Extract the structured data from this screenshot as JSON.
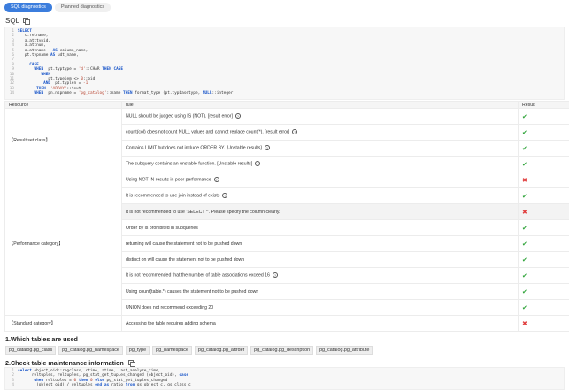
{
  "tabs": [
    "SQL diagnostics",
    "Planned diagnostics"
  ],
  "sql_section": {
    "title": "SQL",
    "lines": [
      {
        "n": "1",
        "parts": [
          {
            "t": "SELECT",
            "c": "kw"
          }
        ]
      },
      {
        "n": "2",
        "parts": [
          {
            "t": "   c.relname,",
            "c": ""
          }
        ]
      },
      {
        "n": "3",
        "parts": [
          {
            "t": "   a.atttypid,",
            "c": ""
          }
        ]
      },
      {
        "n": "4",
        "parts": [
          {
            "t": "   a.attnum,",
            "c": ""
          }
        ]
      },
      {
        "n": "5",
        "parts": [
          {
            "t": "   a.attname   ",
            "c": ""
          },
          {
            "t": "AS",
            "c": "kw"
          },
          {
            "t": " column_name,",
            "c": ""
          }
        ]
      },
      {
        "n": "6",
        "parts": [
          {
            "t": "   pt.typname ",
            "c": ""
          },
          {
            "t": "AS",
            "c": "kw"
          },
          {
            "t": " udt_name,",
            "c": ""
          }
        ]
      },
      {
        "n": "7",
        "parts": [
          {
            "t": "",
            "c": ""
          }
        ]
      },
      {
        "n": "8",
        "parts": [
          {
            "t": "     ",
            "c": ""
          },
          {
            "t": "CASE",
            "c": "kw"
          }
        ]
      },
      {
        "n": "9",
        "parts": [
          {
            "t": "       ",
            "c": ""
          },
          {
            "t": "WHEN",
            "c": "kw"
          },
          {
            "t": "  pt.typtype = ",
            "c": ""
          },
          {
            "t": "'d'",
            "c": "str"
          },
          {
            "t": "::CHAR ",
            "c": ""
          },
          {
            "t": "THEN",
            "c": "kw"
          },
          {
            "t": " ",
            "c": ""
          },
          {
            "t": "CASE",
            "c": "kw"
          }
        ]
      },
      {
        "n": "10",
        "parts": [
          {
            "t": "          ",
            "c": ""
          },
          {
            "t": "WHEN",
            "c": "kw"
          }
        ]
      },
      {
        "n": "11",
        "parts": [
          {
            "t": "             pt.typelem <> ",
            "c": ""
          },
          {
            "t": "0",
            "c": "str"
          },
          {
            "t": "::oid",
            "c": ""
          }
        ]
      },
      {
        "n": "12",
        "parts": [
          {
            "t": "           ",
            "c": ""
          },
          {
            "t": "AND",
            "c": "kw"
          },
          {
            "t": "  pt.typlen = ",
            "c": ""
          },
          {
            "t": "-1",
            "c": "str"
          }
        ]
      },
      {
        "n": "13",
        "parts": [
          {
            "t": "        ",
            "c": ""
          },
          {
            "t": "THEN",
            "c": "kw"
          },
          {
            "t": "  ",
            "c": ""
          },
          {
            "t": "'ARRAY'",
            "c": "str"
          },
          {
            "t": "::text",
            "c": ""
          }
        ]
      },
      {
        "n": "14",
        "parts": [
          {
            "t": "       ",
            "c": ""
          },
          {
            "t": "WHEN",
            "c": "kw"
          },
          {
            "t": "  pn.nspname = ",
            "c": ""
          },
          {
            "t": "'pg_catalog'",
            "c": "str"
          },
          {
            "t": "::name ",
            "c": ""
          },
          {
            "t": "THEN",
            "c": "kw"
          },
          {
            "t": " format_type (pt.typbasetype, ",
            "c": ""
          },
          {
            "t": "NULL",
            "c": "kw"
          },
          {
            "t": "::integer",
            "c": ""
          }
        ]
      }
    ]
  },
  "table": {
    "headers": {
      "resource": "Resource",
      "rule": "rule",
      "result": "Result"
    },
    "groups": [
      {
        "category": "【Result set class】",
        "rows": [
          {
            "rule": "NULL should be judged using IS (NOT). [result error]",
            "help": true,
            "result": "pass"
          },
          {
            "rule": "count(col) does not count NULL values and cannot replace count(*). [result error]",
            "help": true,
            "result": "pass"
          },
          {
            "rule": "Contains LIMIT but does not include ORDER BY. [Unstable results]",
            "help": true,
            "result": "pass"
          },
          {
            "rule": "The subquery contains an unstable function. [Unstable results]",
            "help": true,
            "result": "pass"
          }
        ]
      },
      {
        "category": "【Performance category】",
        "rows": [
          {
            "rule": "Using NOT IN results in poor performance",
            "help": true,
            "result": "fail"
          },
          {
            "rule": "It is recommended to use join instead of exists",
            "help": true,
            "result": "pass"
          },
          {
            "rule": "It is not recommended to use 'SELECT *'. Please specify the column clearly.",
            "help": false,
            "result": "fail",
            "highlight": true
          },
          {
            "rule": "Order by is prohibited in subqueries",
            "help": false,
            "result": "pass"
          },
          {
            "rule": "returning will cause the statement not to be pushed down",
            "help": false,
            "result": "pass"
          },
          {
            "rule": "distinct on will cause the statement not to be pushed down",
            "help": false,
            "result": "pass"
          },
          {
            "rule": "It is not recommended that the number of table associations exceed 16",
            "help": true,
            "result": "pass"
          },
          {
            "rule": "Using count(table.*) causes the statement not to be pushed down",
            "help": false,
            "result": "pass"
          },
          {
            "rule": "UNION does not recommend exceeding 20",
            "help": false,
            "result": "pass"
          }
        ]
      },
      {
        "category": "【Standard category】",
        "rows": [
          {
            "rule": "Accessing the table requires adding schema",
            "help": false,
            "result": "fail"
          }
        ]
      }
    ]
  },
  "section1": {
    "title": "1.Which tables are used",
    "tags": [
      "pg_catalog.pg_class",
      "pg_catalog.pg_namespace",
      "pg_type",
      "pg_namespace",
      "pg_catalog.pg_attrdef",
      "pg_catalog.pg_description",
      "pg_catalog.pg_attribute"
    ]
  },
  "section2": {
    "title": "2.Check table maintenance information",
    "lines": [
      {
        "n": "1",
        "parts": [
          {
            "t": "select",
            "c": "kw"
          },
          {
            "t": " object_oid::regclass, ctime, atime, last_analyze_time,",
            "c": ""
          }
        ]
      },
      {
        "n": "2",
        "parts": [
          {
            "t": "      reltuples, reltuples, pg_stat_get_tuples_changed (object_oid), ",
            "c": ""
          },
          {
            "t": "case",
            "c": "kw"
          }
        ]
      },
      {
        "n": "3",
        "parts": [
          {
            "t": "       ",
            "c": ""
          },
          {
            "t": "when",
            "c": "kw"
          },
          {
            "t": " reltuples = ",
            "c": ""
          },
          {
            "t": "0",
            "c": "str"
          },
          {
            "t": " ",
            "c": ""
          },
          {
            "t": "then",
            "c": "kw"
          },
          {
            "t": " ",
            "c": ""
          },
          {
            "t": "0",
            "c": "str"
          },
          {
            "t": " ",
            "c": ""
          },
          {
            "t": "else",
            "c": "kw"
          },
          {
            "t": " pg_stat_get_tuples_changed",
            "c": ""
          }
        ]
      },
      {
        "n": "4",
        "parts": [
          {
            "t": "        (object_oid) / reltuples ",
            "c": ""
          },
          {
            "t": "end",
            "c": "kw"
          },
          {
            "t": " ",
            "c": ""
          },
          {
            "t": "as",
            "c": "kw"
          },
          {
            "t": " ratio ",
            "c": ""
          },
          {
            "t": "from",
            "c": "kw"
          },
          {
            "t": " gs_object c, gs_class c",
            "c": ""
          }
        ]
      }
    ]
  }
}
